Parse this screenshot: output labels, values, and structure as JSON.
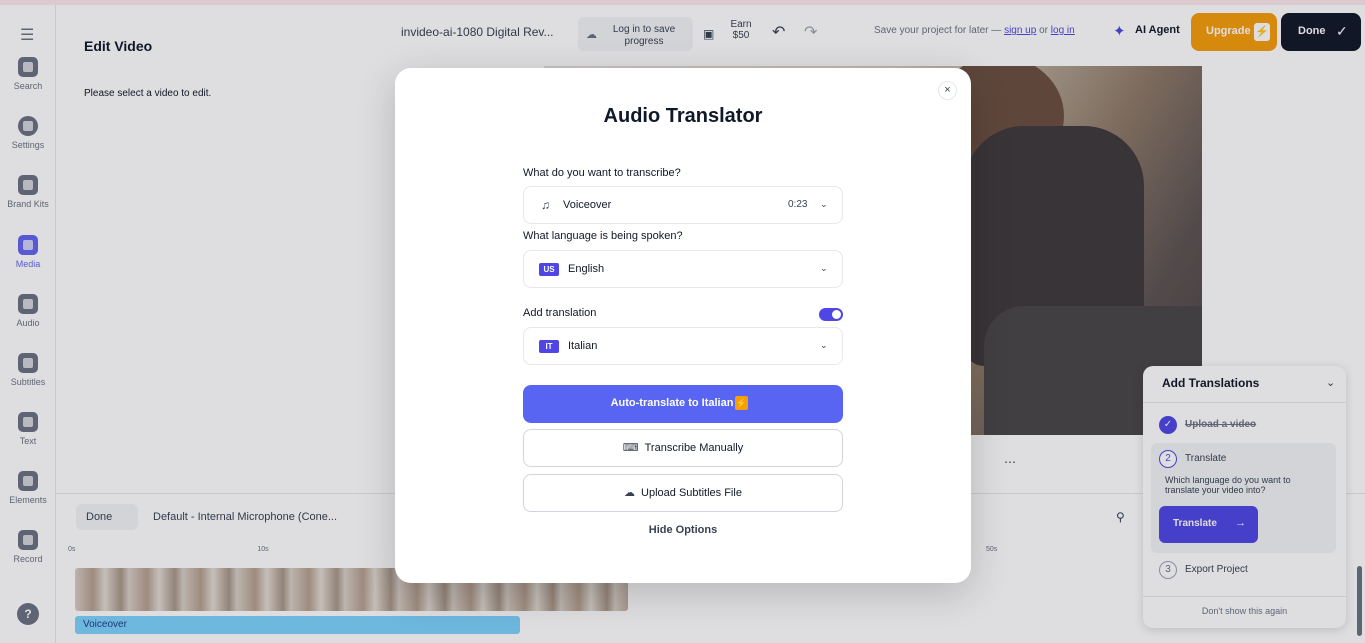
{
  "sidebar": {
    "items": [
      {
        "label": "Search"
      },
      {
        "label": "Settings"
      },
      {
        "label": "Brand Kits"
      },
      {
        "label": "Media"
      },
      {
        "label": "Audio"
      },
      {
        "label": "Subtitles"
      },
      {
        "label": "Text"
      },
      {
        "label": "Elements"
      },
      {
        "label": "Record"
      }
    ],
    "help": "?"
  },
  "edit_panel": {
    "title": "Edit Video",
    "message": "Please select a video to edit."
  },
  "header": {
    "project_name": "invideo-ai-1080 Digital Rev...",
    "login_label": "Log in to save progress",
    "earn_label": "Earn $50",
    "save_prefix": "Save your project for later —",
    "sign_up": "sign up",
    "or": "or",
    "log_in": "log in",
    "ai_agent": "AI Agent",
    "upgrade": "Upgrade",
    "done": "Done"
  },
  "timeline": {
    "done": "Done",
    "microphone": "Default - Internal Microphone (Cone...",
    "ruler_start": "0s",
    "ruler_mid": "10s",
    "ruler_end": "50s",
    "audio_label": "Voiceover"
  },
  "guide": {
    "title": "Add Translations",
    "step1": "Upload a video",
    "step2_num": "2",
    "step2": "Translate",
    "question": "Which language do you want to translate your video into?",
    "translate_button": "Translate",
    "step3_num": "3",
    "step3": "Export Project",
    "dont_show": "Don't show this again"
  },
  "modal": {
    "title": "Audio Translator",
    "transcribe_label": "What do you want to transcribe?",
    "transcribe_value": "Voiceover",
    "transcribe_duration": "0:23",
    "language_label": "What language is being spoken?",
    "language_flag": "US",
    "language_value": "English",
    "translation_label": "Add translation",
    "translation_enabled": true,
    "translation_flag": "IT",
    "translation_value": "Italian",
    "auto_translate": "Auto-translate to Italian",
    "transcribe_manually": "Transcribe Manually",
    "upload_subtitles": "Upload Subtitles File",
    "hide_options": "Hide Options"
  },
  "colors": {
    "accent": "#5865f2",
    "upgrade": "#f59e0b",
    "dark": "#111827"
  }
}
